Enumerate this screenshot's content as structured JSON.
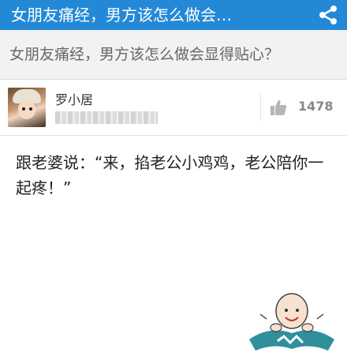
{
  "header": {
    "title": "女朋友痛经，男方该怎么做会…",
    "share_icon": "share-icon"
  },
  "question": {
    "text": "女朋友痛经，男方该怎么做会显得贴心？"
  },
  "author": {
    "name": "罗小居",
    "like_count": "1478",
    "like_icon": "thumbs-up-icon"
  },
  "answer": {
    "text": "跟老婆说：“来，掐老公小鸡鸡，老公陪你一起疼！”"
  },
  "colors": {
    "topbar": "#2389d6",
    "question_bg": "#f2f2f2",
    "like_gray": "#999999"
  }
}
